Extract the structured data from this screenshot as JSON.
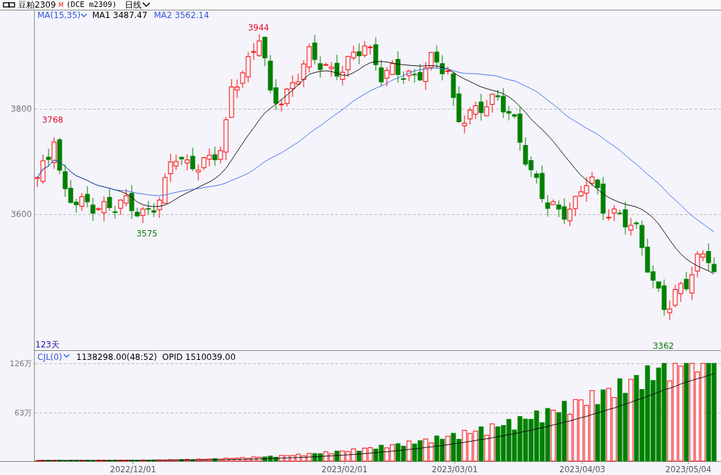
{
  "header": {
    "symbol": "豆粕2309",
    "symbol_mark": "M",
    "code": "(DCE m2309)",
    "period": "日线"
  },
  "price_panel": {
    "indicator": "MA(15,35)",
    "ma1": "MA1 3487.47",
    "ma2": "MA2 3562.14",
    "y_labels": [
      "3800",
      "3600"
    ],
    "day_count": "123天",
    "price_marks": [
      {
        "text": "3768",
        "kind": "high"
      },
      {
        "text": "3944",
        "kind": "high"
      },
      {
        "text": "3575",
        "kind": "low"
      },
      {
        "text": "3362",
        "kind": "low"
      }
    ]
  },
  "volume_panel": {
    "indicator": "CJL(0)",
    "volume": "1138298.00(48:52)",
    "open_interest": "OPID 1510039.00",
    "y_labels": [
      "126万",
      "63万"
    ]
  },
  "x_axis": [
    "2022/12/01",
    "2023/02/01",
    "2023/03/01",
    "2023/04/03",
    "2023/05/04"
  ]
}
